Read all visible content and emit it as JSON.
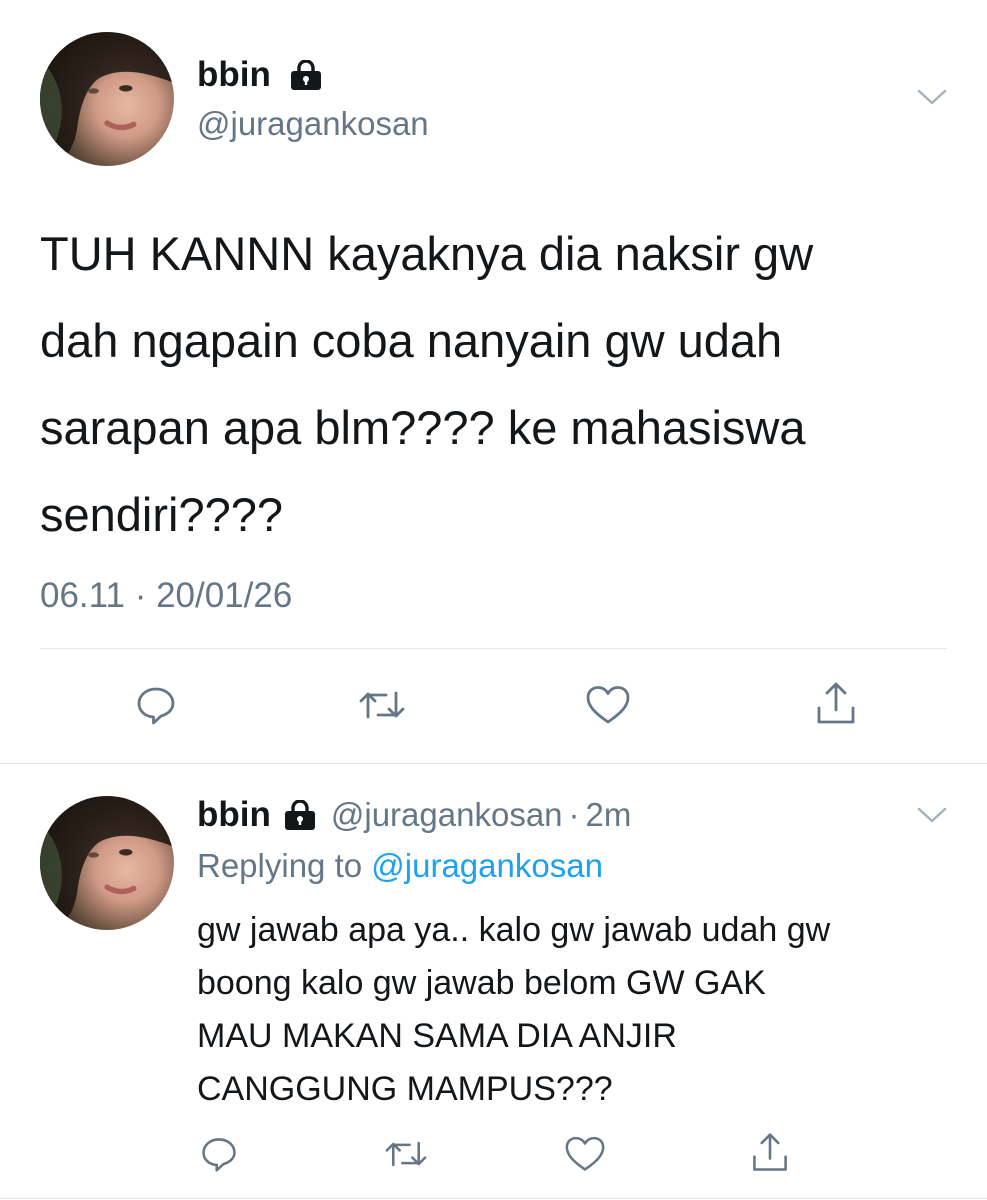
{
  "main_tweet": {
    "display_name": "bbin",
    "handle": "@juragankosan",
    "text_lines": [
      "TUH KANNN kayaknya dia naksir gw",
      "dah ngapain coba nanyain gw udah",
      "sarapan apa blm???? ke mahasiswa",
      "sendiri????"
    ],
    "timestamp": "06.11 · 20/01/26",
    "icons": {
      "lock": "lock-icon",
      "menu": "chevron-down-icon",
      "reply": "reply-icon",
      "retweet": "retweet-icon",
      "like": "like-icon",
      "share": "share-icon"
    }
  },
  "reply_tweet": {
    "display_name": "bbin",
    "handle": "@juragankosan",
    "separator": "·",
    "time_ago": "2m",
    "replying_prefix": "Replying to",
    "replying_handle": "@juragankosan",
    "text_lines": [
      "gw jawab apa ya.. kalo gw jawab udah gw",
      "boong kalo gw jawab belom GW GAK",
      "MAU MAKAN SAMA DIA ANJIR",
      "CANGGUNG MAMPUS???"
    ]
  },
  "colors": {
    "text": "#14171a",
    "muted": "#657786",
    "link": "#1da1f2",
    "divider": "#e1e8ed"
  }
}
